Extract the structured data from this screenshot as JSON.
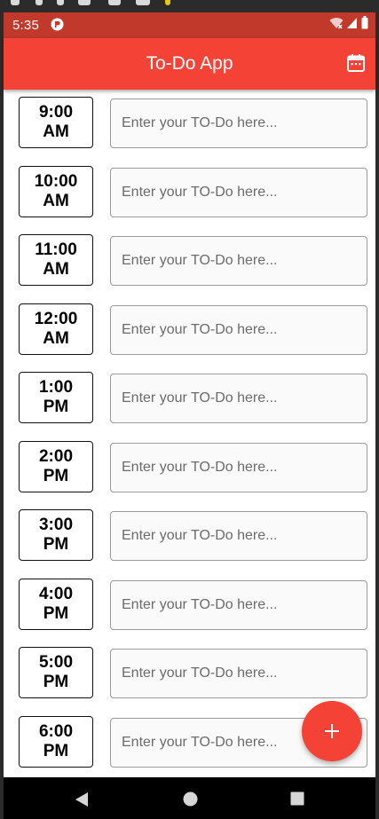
{
  "status_bar": {
    "time": "5:35",
    "icons": [
      "app-notification-icon",
      "wifi-icon",
      "signal-icon",
      "battery-icon"
    ]
  },
  "app_bar": {
    "title": "To-Do App",
    "action_icon": "calendar-icon"
  },
  "slots": [
    {
      "time_line1": "9:00",
      "time_line2": "AM",
      "placeholder": "Enter your TO-Do here...",
      "value": ""
    },
    {
      "time_line1": "10:00",
      "time_line2": "AM",
      "placeholder": "Enter your TO-Do here...",
      "value": ""
    },
    {
      "time_line1": "11:00",
      "time_line2": "AM",
      "placeholder": "Enter your TO-Do here...",
      "value": ""
    },
    {
      "time_line1": "12:00",
      "time_line2": "AM",
      "placeholder": "Enter your TO-Do here...",
      "value": ""
    },
    {
      "time_line1": "1:00",
      "time_line2": "PM",
      "placeholder": "Enter your TO-Do here...",
      "value": ""
    },
    {
      "time_line1": "2:00",
      "time_line2": "PM",
      "placeholder": "Enter your TO-Do here...",
      "value": ""
    },
    {
      "time_line1": "3:00",
      "time_line2": "PM",
      "placeholder": "Enter your TO-Do here...",
      "value": ""
    },
    {
      "time_line1": "4:00",
      "time_line2": "PM",
      "placeholder": "Enter your TO-Do here...",
      "value": ""
    },
    {
      "time_line1": "5:00",
      "time_line2": "PM",
      "placeholder": "Enter your TO-Do here...",
      "value": ""
    },
    {
      "time_line1": "6:00",
      "time_line2": "PM",
      "placeholder": "Enter your TO-Do here...",
      "value": ""
    }
  ],
  "fab": {
    "icon": "plus-icon"
  },
  "nav_bar": {
    "buttons": [
      "back-icon",
      "home-icon",
      "recents-icon"
    ]
  },
  "colors": {
    "status_bar": "#c0392b",
    "app_bar": "#f44336",
    "fab": "#f44336",
    "nav_bar": "#000000",
    "content_background": "#ffffff"
  }
}
